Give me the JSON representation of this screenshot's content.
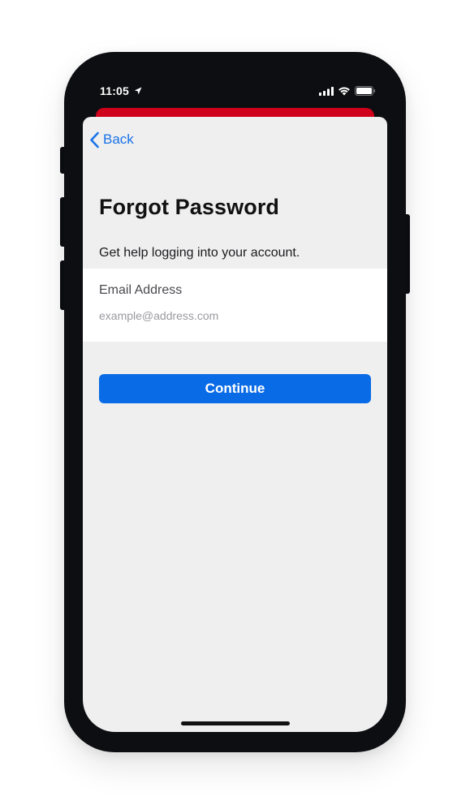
{
  "status_bar": {
    "time": "11:05",
    "icons": [
      "location-arrow-icon",
      "cellular-signal-icon",
      "wifi-icon",
      "battery-icon"
    ]
  },
  "nav": {
    "back_label": "Back"
  },
  "page": {
    "title": "Forgot Password",
    "subtitle": "Get help logging into your account."
  },
  "form": {
    "email_label": "Email Address",
    "email_value": "",
    "email_placeholder": "example@address.com",
    "submit_label": "Continue"
  },
  "colors": {
    "accent": "#0a6be6",
    "link": "#1a73e8",
    "header_card": "#d0021b",
    "sheet_background": "#efeff0",
    "device_frame": "#0d0e12"
  }
}
